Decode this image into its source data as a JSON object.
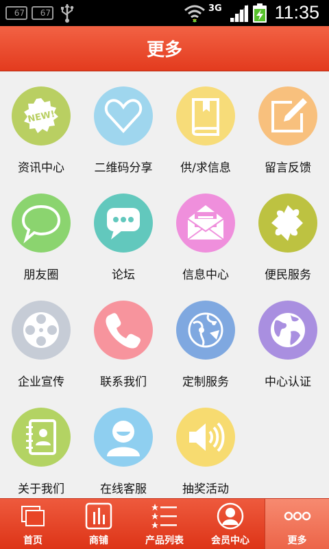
{
  "status_bar": {
    "notif_1": "67",
    "notif_2": "67",
    "network": "3G",
    "time": "11:35",
    "icons": [
      "usb-icon",
      "wifi-icon",
      "signal-icon",
      "battery-icon"
    ]
  },
  "header": {
    "title": "更多"
  },
  "grid": {
    "items": [
      {
        "label": "资讯中心",
        "icon": "new-badge-icon",
        "color": "#b9cf62"
      },
      {
        "label": "二维码分享",
        "icon": "heart-icon",
        "color": "#9fd6ee"
      },
      {
        "label": "供/求信息",
        "icon": "book-icon",
        "color": "#f7dc79"
      },
      {
        "label": "留言反馈",
        "icon": "edit-icon",
        "color": "#f8c07d"
      },
      {
        "label": "朋友圈",
        "icon": "speech-bubble-icon",
        "color": "#8bd46f"
      },
      {
        "label": "论坛",
        "icon": "chat-icon",
        "color": "#62c8bd"
      },
      {
        "label": "信息中心",
        "icon": "envelope-icon",
        "color": "#ef8fdc"
      },
      {
        "label": "便民服务",
        "icon": "puzzle-icon",
        "color": "#bdc241"
      },
      {
        "label": "企业宣传",
        "icon": "film-reel-icon",
        "color": "#c6ccd6"
      },
      {
        "label": "联系我们",
        "icon": "phone-icon",
        "color": "#f7949d"
      },
      {
        "label": "定制服务",
        "icon": "network-globe-icon",
        "color": "#7fa8e0"
      },
      {
        "label": "中心认证",
        "icon": "globe-icon",
        "color": "#a98fe0"
      },
      {
        "label": "关于我们",
        "icon": "contacts-book-icon",
        "color": "#b3d363"
      },
      {
        "label": "在线客服",
        "icon": "user-icon",
        "color": "#8fcff0"
      },
      {
        "label": "抽奖活动",
        "icon": "speaker-icon",
        "color": "#f7db70"
      }
    ]
  },
  "tabbar": {
    "items": [
      {
        "label": "首页",
        "icon": "home-windows-icon",
        "active": false
      },
      {
        "label": "商铺",
        "icon": "shop-chart-icon",
        "active": false
      },
      {
        "label": "产品列表",
        "icon": "star-list-icon",
        "active": false
      },
      {
        "label": "会员中心",
        "icon": "member-icon",
        "active": false
      },
      {
        "label": "更多",
        "icon": "more-dots-icon",
        "active": true
      }
    ]
  },
  "colors": {
    "header": "#e84a2b",
    "tabbar": "#e43f21",
    "tab_active": "#f27659",
    "background": "#f0f0f0"
  }
}
